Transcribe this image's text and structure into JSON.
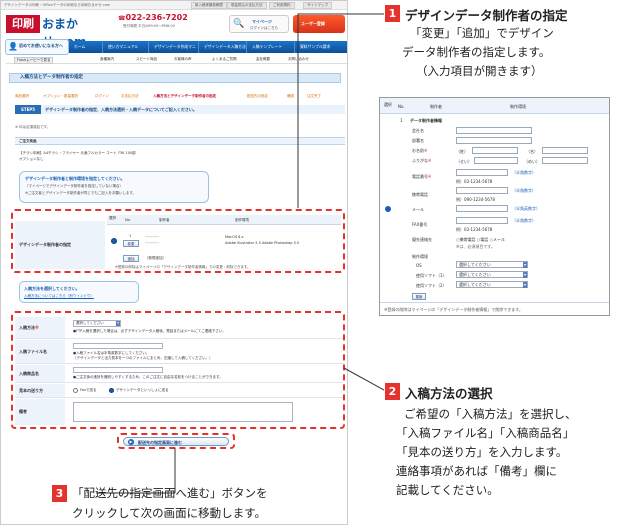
{
  "header": {
    "tagline": "デザインデータの印刷・Officeデータの印刷なら印刷おまかせ.com",
    "top_links": [
      "新入稿体験依頼表",
      "現金振込の支払方法",
      "ご利用規約",
      "サイトマップ"
    ],
    "logo_mark": "印刷",
    "logo_word": "おまかせ.com",
    "tel": "022-236-7202",
    "tel_note": "受付時間 平日AM9:00～PM6:00",
    "mypage_label": "マイページ",
    "mypage_sub": "ログインはこちら",
    "register_label": "ユーザー登録"
  },
  "nav": {
    "first_time": "初めてお使いになる方へ",
    "items": [
      "ホーム",
      "使い方マニュアル",
      "デザインデータ作成マニュアル",
      "デザインデータ入稿方法",
      "入稿テンプレート",
      "資料サンプル請求"
    ],
    "sub_items": [
      "Flashムービーで見る",
      "各種案内",
      "スピード商品",
      "お客様の声",
      "よくあるご質問",
      "会社概要",
      "お問い合わせ"
    ]
  },
  "page": {
    "section_title": "入稿方法とデータ制作者の指定",
    "breadcrumb": [
      "商品選択",
      "オプション・数量選択",
      "ログイン",
      "お支払方法",
      "入稿方法とデザインデータ制作者の指定",
      "配送先の指定",
      "確認",
      "注文完了"
    ],
    "step_badge": "STEP5",
    "step_text": "デザインデータ制作者の指定、入稿方法選択・入稿データについてご記入ください。",
    "required_note": "※ 印は必須項目です。",
    "order_item_head": "ご注文商品",
    "order_item_text": "【チラシ印刷】A4チラシ・フライヤー 片面フルカラー コート 73K 100部",
    "order_item_opt": "オプションなし",
    "designer_note": "デザインデータ制作者と制作環境を指定してください。",
    "designer_note_2": "（マイページでデザインデータ制作者を指定していない場合）",
    "designer_note_3": "※ご注文者とデザインデータ制作者が同じでもご記入をお願いします。",
    "designer_label": "デザインデータ制作者の指定",
    "col_select": "選択",
    "col_no": "No.",
    "col_maker": "制作者",
    "col_env": "制作環境",
    "row_no": "1",
    "change_btn": "変更",
    "add_btn": "追加",
    "add_note": "（新規追加）",
    "env_1": "MacOS 8.x",
    "env_2": "Adobe Illustrator 5.5   Adobe Photoshop 5.5",
    "mypage_note": "※登録の削除はマイページの「デザインデータ制作者情報」での変更・削除できます。",
    "method_prompt": "入稿方法を選択してください。",
    "method_link": "入稿方法についてはこちら（別ウインドウ）",
    "method_label": "入稿方法",
    "method_select": "選択してください",
    "method_note": "●FTP入稿を選択した場合は、必ずデザインデータ入稿後、電話またはメールにてご連絡下さい。",
    "file_label": "入稿ファイル名",
    "file_note": "●入稿ファイル名は半角英数字にしてください。",
    "file_note_2": "（デザインデータと出力見本を一つのファイルにまとめ、圧縮して入稿してください。）",
    "product_label": "入稿商品名",
    "product_note": "●ご注文後の進捗を識別しやすくするため、このご注文に自由な名前をつけることができます。",
    "sample_label": "見本の送り方",
    "sample_opt_1": "Faxで送る",
    "sample_opt_2": "デザインデータといっしょに送る",
    "remarks_label": "備考",
    "next_button": "配送先の指定画面に進む"
  },
  "annotations": [
    {
      "num": "1",
      "title": "デザインデータ制作者の指定",
      "lines": [
        "「変更」「追加」でデザイン",
        "データ制作者の指定します。",
        "（入力項目が開きます）"
      ]
    },
    {
      "num": "2",
      "title": "入稿方法の選択",
      "lines": [
        "ご希望の「入稿方法」を選択し、",
        "「入稿ファイル名」「入稿商品名」",
        "「見本の送り方」を入力します。",
        "連絡事項があれば「備考」欄に",
        "記載してください。"
      ]
    },
    {
      "num": "3",
      "title": "「配送先の指定画面へ進む」ボタンを",
      "lines": [
        "クリックして次の画面に移動します。"
      ]
    }
  ],
  "zoom": {
    "col_select": "選択",
    "col_no": "No.",
    "col_maker": "制作者",
    "col_env": "制作環境",
    "row_no": "1",
    "group_title": "データ制作者情報",
    "fields": [
      "会社名",
      "部署名",
      "お名前",
      "ふりがな",
      "電話番号",
      "携帯電話",
      "メール",
      "FAX番号"
    ],
    "sei": "（姓）",
    "mei": "（名）",
    "sei_kana": "（せい）",
    "mei_kana": "（めい）",
    "tel_example": "例）03-1234-5678",
    "mobile_example": "例）090-1234-5678",
    "fax_example": "例）03-1234-5678",
    "half_width": "（半角数字）",
    "half_alnum": "（半角英数字）",
    "contact_label": "優先連絡先",
    "contact_opts": "○携帯電話 ○電話 ○メール",
    "contact_note": "※は、必須項目です。",
    "env_title": "制作環境",
    "os_label": "OS",
    "soft1_label": "使用ソフト（1）",
    "soft2_label": "使用ソフト（2）",
    "select_text": "選択してください",
    "update_btn": "更新",
    "footer_note": "※登録の削除はマイページの「デザインデータ制作者情報」で削除できます。"
  },
  "colors": {
    "accent_red": "#e5322d",
    "brand_blue": "#0b5aa6",
    "nav_blue": "#1b73c9"
  }
}
